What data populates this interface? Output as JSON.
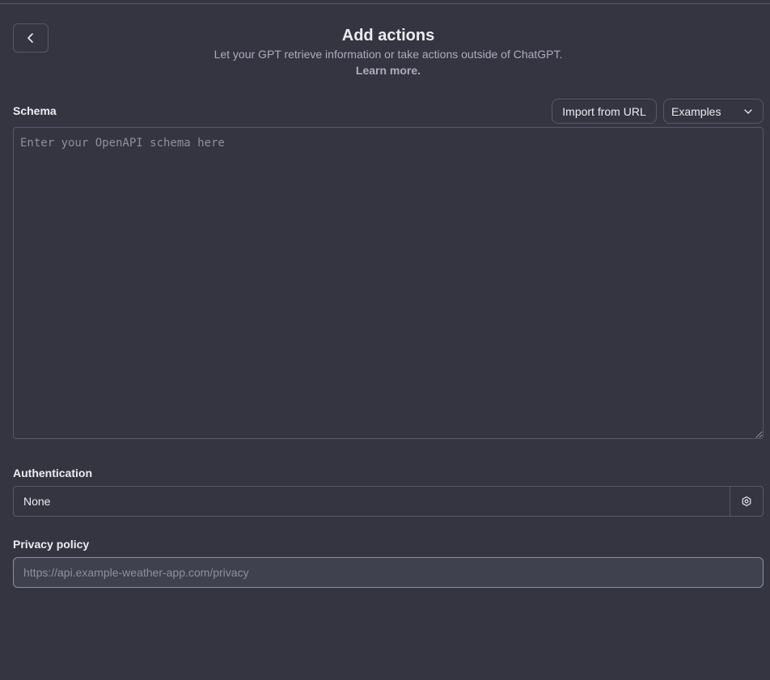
{
  "header": {
    "title": "Add actions",
    "subtitle": "Let your GPT retrieve information or take actions outside of ChatGPT.",
    "learn_more": "Learn more."
  },
  "schema": {
    "label": "Schema",
    "import_button": "Import from URL",
    "examples_select": "Examples",
    "placeholder": "Enter your OpenAPI schema here"
  },
  "authentication": {
    "label": "Authentication",
    "value": "None"
  },
  "privacy": {
    "label": "Privacy policy",
    "placeholder": "https://api.example-weather-app.com/privacy"
  },
  "icons": {
    "back": "chevron-left-icon",
    "dropdown": "chevron-down-icon",
    "settings": "gear-icon"
  },
  "colors": {
    "background": "#343541",
    "border": "#565869",
    "text": "#ececf1",
    "muted_text": "#acacbe",
    "placeholder": "#8e8ea0"
  }
}
